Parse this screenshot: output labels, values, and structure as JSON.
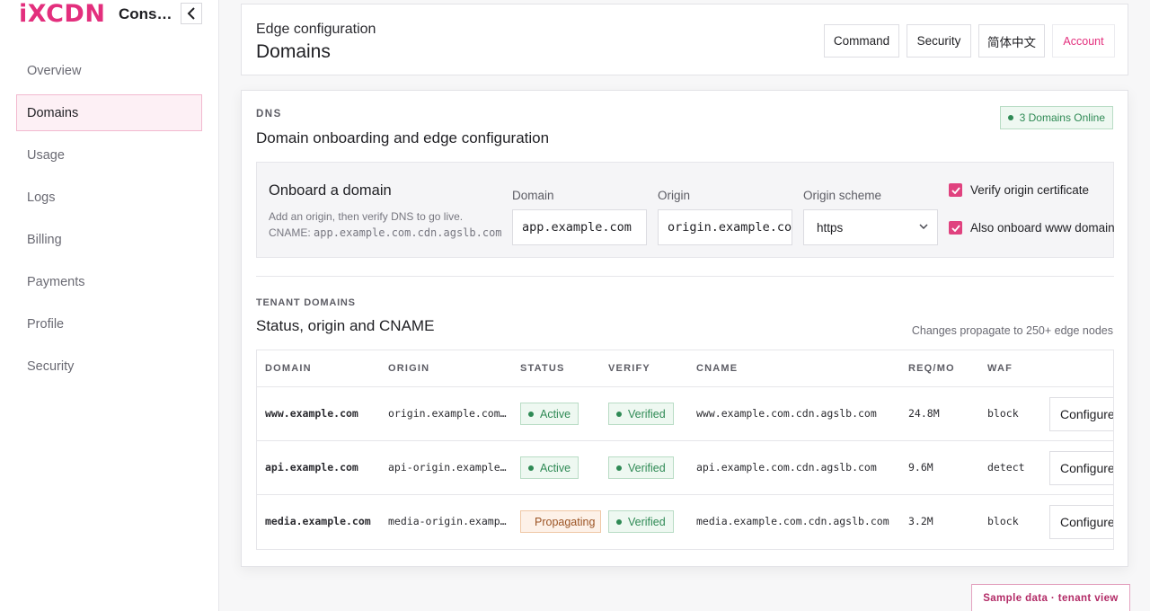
{
  "brand": {
    "logo": "iXCDN",
    "app_title": "Cons…"
  },
  "sidebar": {
    "items": [
      {
        "label": "Overview"
      },
      {
        "label": "Domains",
        "active": true
      },
      {
        "label": "Usage"
      },
      {
        "label": "Logs"
      },
      {
        "label": "Billing"
      },
      {
        "label": "Payments"
      },
      {
        "label": "Profile"
      },
      {
        "label": "Security"
      }
    ]
  },
  "header": {
    "eyebrow": "Edge configuration",
    "title": "Domains",
    "buttons": {
      "command": "Command",
      "security": "Security",
      "language": "简体中文",
      "account": "Account"
    }
  },
  "dns": {
    "eyebrow": "DNS",
    "title": "Domain onboarding and edge configuration",
    "online_badge": "3 Domains Online"
  },
  "onboard": {
    "title": "Onboard a domain",
    "subtitle": "Add an origin, then verify DNS to go live.",
    "cname_label": "CNAME:",
    "cname_value": "app.example.com.cdn.agslb.com",
    "domain_label": "Domain",
    "domain_value": "app.example.com",
    "origin_label": "Origin",
    "origin_value": "origin.example.co",
    "scheme_label": "Origin scheme",
    "scheme_value": "https",
    "verify_cert_label": "Verify origin certificate",
    "verify_cert_checked": true,
    "www_label": "Also onboard www domain",
    "www_checked": true
  },
  "tenant": {
    "eyebrow": "TENANT DOMAINS",
    "title": "Status, origin and CNAME",
    "note": "Changes propagate to 250+ edge nodes",
    "columns": {
      "domain": "DOMAIN",
      "origin": "ORIGIN",
      "status": "STATUS",
      "verify": "VERIFY",
      "cname": "CNAME",
      "req": "REQ/MO",
      "waf": "WAF"
    },
    "rows": [
      {
        "domain": "www.example.com",
        "origin": "origin.example.com…",
        "status": "Active",
        "verify": "Verified",
        "cname": "www.example.com.cdn.agslb.com",
        "req": "24.8M",
        "waf": "block",
        "action": "Configure"
      },
      {
        "domain": "api.example.com",
        "origin": "api-origin.example…",
        "status": "Active",
        "verify": "Verified",
        "cname": "api.example.com.cdn.agslb.com",
        "req": "9.6M",
        "waf": "detect",
        "action": "Configure"
      },
      {
        "domain": "media.example.com",
        "origin": "media-origin.examp…",
        "status": "Propagating",
        "verify": "Verified",
        "cname": "media.example.com.cdn.agslb.com",
        "req": "3.2M",
        "waf": "block",
        "action": "Configure"
      }
    ]
  },
  "footer_tag": "Sample data · tenant view",
  "colors": {
    "accent": "#e32f7d",
    "success": "#2f8a55",
    "warning": "#9c5424"
  }
}
